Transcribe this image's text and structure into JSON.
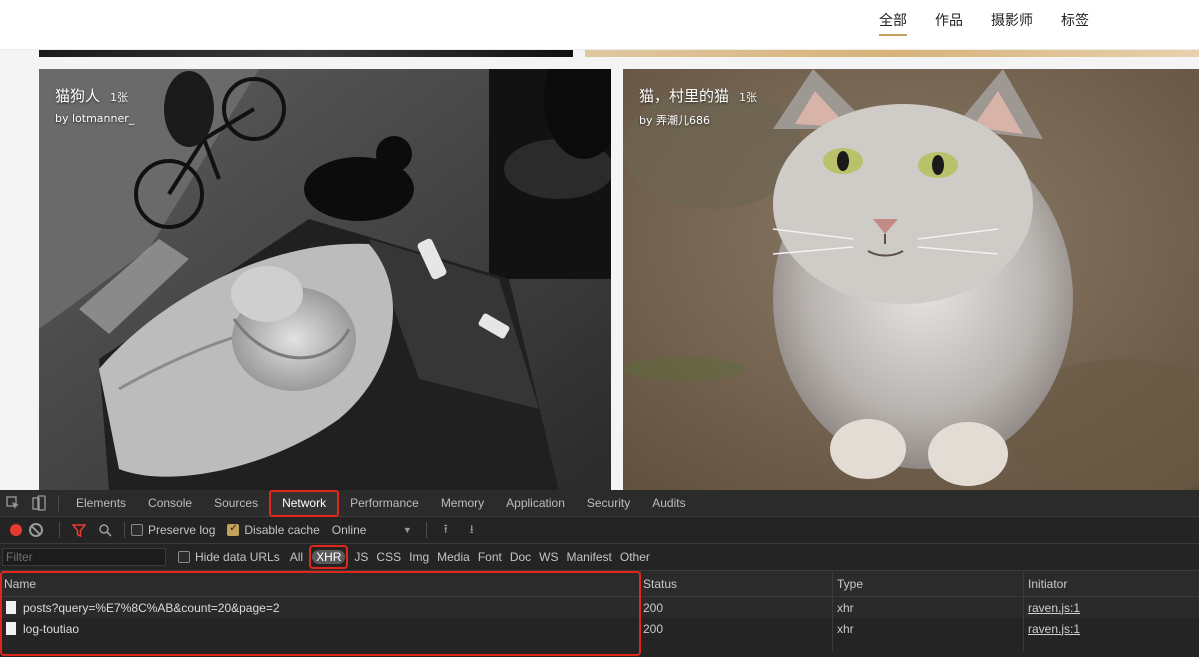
{
  "site": {
    "nav": [
      "全部",
      "作品",
      "摄影师",
      "标签"
    ]
  },
  "cards": [
    {
      "title": "猫狗人",
      "count": "1张",
      "author": "by lotmanner_"
    },
    {
      "title": "猫，村里的猫",
      "count": "1张",
      "author": "by 弄潮儿686"
    }
  ],
  "devtools": {
    "tabs": [
      "Elements",
      "Console",
      "Sources",
      "Network",
      "Performance",
      "Memory",
      "Application",
      "Security",
      "Audits"
    ],
    "active_tab": "Network",
    "toolbar": {
      "preserve_log": "Preserve log",
      "disable_cache": "Disable cache",
      "throttle": "Online",
      "throttle_arrow": "▼",
      "upload_icon": "⭱",
      "download_icon": "⭳"
    },
    "filter": {
      "placeholder": "Filter",
      "hide_data_urls": "Hide data URLs",
      "types": [
        "All",
        "XHR",
        "JS",
        "CSS",
        "Img",
        "Media",
        "Font",
        "Doc",
        "WS",
        "Manifest",
        "Other"
      ],
      "active_type": "XHR"
    },
    "table": {
      "headers": {
        "name": "Name",
        "status": "Status",
        "type": "Type",
        "initiator": "Initiator"
      },
      "rows": [
        {
          "name": "posts?query=%E7%8C%AB&count=20&page=2",
          "status": "200",
          "type": "xhr",
          "initiator": "raven.js:1"
        },
        {
          "name": "log-toutiao",
          "status": "200",
          "type": "xhr",
          "initiator": "raven.js:1"
        }
      ]
    }
  },
  "colors": {
    "accent": "#c4a15a",
    "highlight": "#e0271c",
    "record": "#e63b30"
  }
}
